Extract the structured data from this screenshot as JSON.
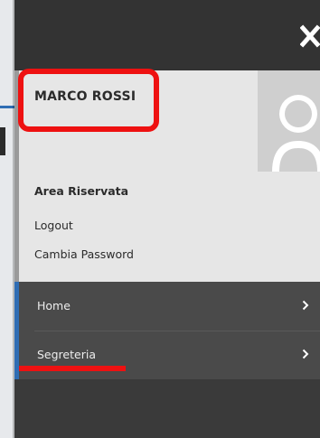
{
  "user": {
    "name": "MARCO ROSSI",
    "section_title": "Area Riservata",
    "links": [
      "Logout",
      "Cambia Password"
    ]
  },
  "menu": {
    "items": [
      {
        "label": "Home",
        "icon": "chevron-right-icon"
      },
      {
        "label": "Segreteria",
        "icon": "chevron-right-icon"
      }
    ]
  },
  "icons": {
    "close": "close-icon",
    "avatar": "user-avatar-icon"
  },
  "colors": {
    "accent_blue": "#2f6db4",
    "annotation_red": "#ee1111",
    "drawer_dark": "#3a3a3a",
    "user_panel": "#e6e6e6",
    "menu_bg": "#4a4a4a"
  }
}
